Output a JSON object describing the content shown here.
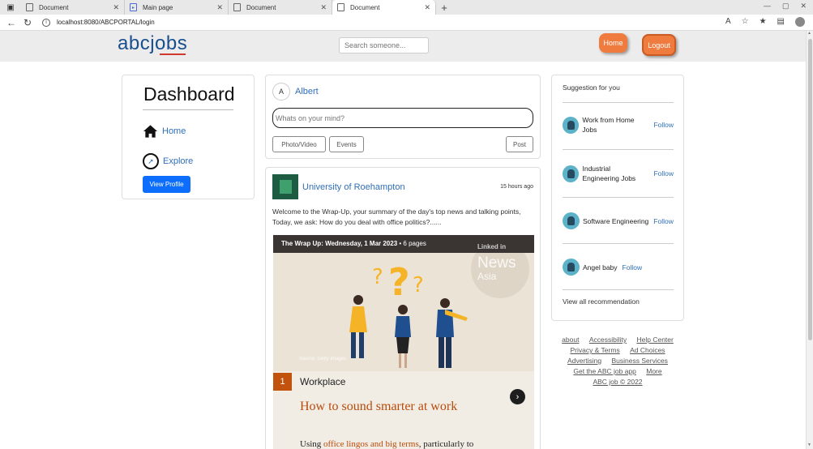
{
  "browser": {
    "tabs": [
      {
        "title": "Document",
        "active": false
      },
      {
        "title": "Main page",
        "active": false
      },
      {
        "title": "Document",
        "active": false
      },
      {
        "title": "Document",
        "active": true
      }
    ],
    "url": "localhost:8080/ABCPORTAL/login"
  },
  "header": {
    "logo": "abcjobs",
    "search_placeholder": "Search someone...",
    "home_label": "Home",
    "logout_label": "Logout",
    "accent_color": "#f07b3f"
  },
  "sidebar": {
    "title": "Dashboard",
    "links": [
      {
        "label": "Home",
        "icon": "house-icon"
      },
      {
        "label": "Explore",
        "icon": "compass-icon"
      }
    ],
    "view_profile_label": "View Profile"
  },
  "composer": {
    "avatar_initial": "A",
    "user_name": "Albert",
    "placeholder": "Whats on your mind?",
    "photo_video_label": "Photo/Video",
    "events_label": "Events",
    "post_label": "Post"
  },
  "feed": {
    "author": "University of Roehampton",
    "time": "15 hours ago",
    "text": "Welcome to the Wrap-Up, your summary of the day's top news and talking points, Today, we ask: How do you deal with office politics?......",
    "media": {
      "header_bold": "The Wrap Up: Wednesday, 1 Mar 2023",
      "header_rest": " • 6 pages",
      "brand_top": "Linked in",
      "brand_news": "News",
      "brand_region": "Asia",
      "source": "Source: Getty Images",
      "item_number": "1",
      "category": "Workplace",
      "headline": "How to sound smarter at work",
      "cut_text_prefix": "Using ",
      "cut_text_highlight": "office lingos and big terms",
      "cut_text_suffix": ", particularly to"
    }
  },
  "suggestions": {
    "title": "Suggestion for you",
    "items": [
      {
        "name": "Work from Home Jobs",
        "follow": "Follow"
      },
      {
        "name": "Industrial Engineering Jobs",
        "follow": "Follow"
      },
      {
        "name": "Software Engineering",
        "follow": "Follow"
      },
      {
        "name": "Angel baby",
        "follow": "Follow"
      }
    ],
    "view_all": "View all recommendation"
  },
  "footer": {
    "links": [
      "about",
      "Accessibility",
      "Help Center",
      "Privacy & Terms",
      "Ad Choices",
      "Advertising",
      "Business Services",
      "Get the ABC job app",
      "More"
    ],
    "copyright": "ABC job © 2022"
  }
}
